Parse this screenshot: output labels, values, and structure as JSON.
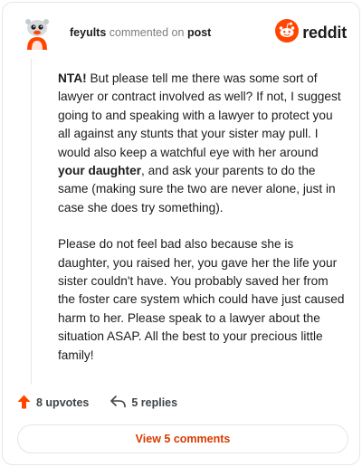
{
  "header": {
    "username": "feyults",
    "action_text": "commented on",
    "target_text": "post",
    "brand_name": "reddit",
    "brand_color": "#ff4500",
    "avatar_icon": "snoo-avatar-icon"
  },
  "comment": {
    "p1": {
      "bold_lead": "NTA!",
      "text_a": " But please tell me there was some sort of lawyer or contract involved as well? If not, I suggest going to and speaking with a lawyer to protect you all against any stunts that your sister may pull. I would also keep a watchful eye with her around ",
      "bold_mid": "your daughter",
      "text_b": ", and ask your parents to do the same (making sure the two are never alone, just in case she does try something)."
    },
    "p2": "Please do not feel bad also because she is daughter, you raised her, you gave her the life your sister couldn't have. You probably saved her from the foster care system which could have just caused harm to her. Please speak to a lawyer about the situation ASAP. All the best to your precious little family!"
  },
  "actions": {
    "upvotes_label": "8 upvotes",
    "replies_label": "5 replies",
    "upvote_color": "#ff4500"
  },
  "footer": {
    "view_button_label": "View 5 comments"
  }
}
